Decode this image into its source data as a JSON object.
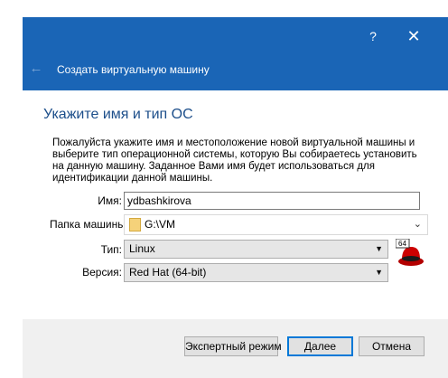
{
  "titlebar": {
    "help": "?",
    "close": "✕",
    "back": "←",
    "wizard_title": "Создать виртуальную машину",
    "color": "#1a65b6"
  },
  "page": {
    "title": "Укажите имя и тип ОС",
    "description": "Пожалуйста укажите имя и местоположение новой виртуальной машины и выберите тип операционной системы, которую Вы собираетесь установить на данную машину. Заданное Вами имя будет использоваться для идентификации данной машины."
  },
  "form": {
    "name_label": "Имя:",
    "name_value": "ydbashkirova",
    "folder_label": "Папка машины:",
    "folder_value": "G:\\VM",
    "type_label": "Тип:",
    "type_value": "Linux",
    "version_label": "Версия:",
    "version_value": "Red Hat (64-bit)",
    "os_icon": "redhat-64-icon",
    "os_icon_badge": "64"
  },
  "buttons": {
    "expert": "Экспертный режим",
    "next": "Далее",
    "cancel": "Отмена"
  }
}
